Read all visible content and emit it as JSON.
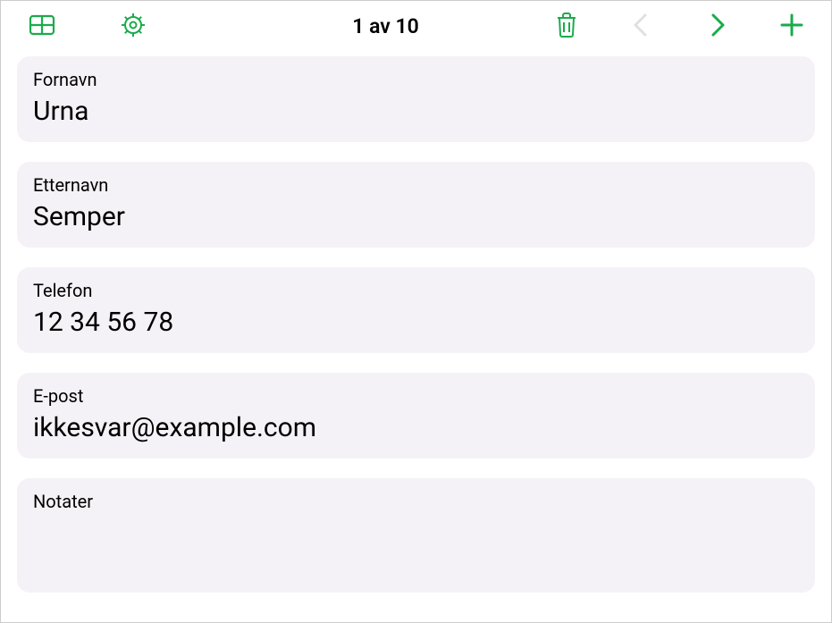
{
  "toolbar": {
    "counter": "1 av 10"
  },
  "fields": [
    {
      "label": "Fornavn",
      "value": "Urna"
    },
    {
      "label": "Etternavn",
      "value": "Semper"
    },
    {
      "label": "Telefon",
      "value": "12 34 56 78"
    },
    {
      "label": "E-post",
      "value": "ikkesvar@example.com"
    },
    {
      "label": "Notater",
      "value": ""
    }
  ],
  "colors": {
    "accent": "#1aab4c",
    "disabled": "#a9a9a9",
    "cardBg": "#f5f2f7"
  }
}
